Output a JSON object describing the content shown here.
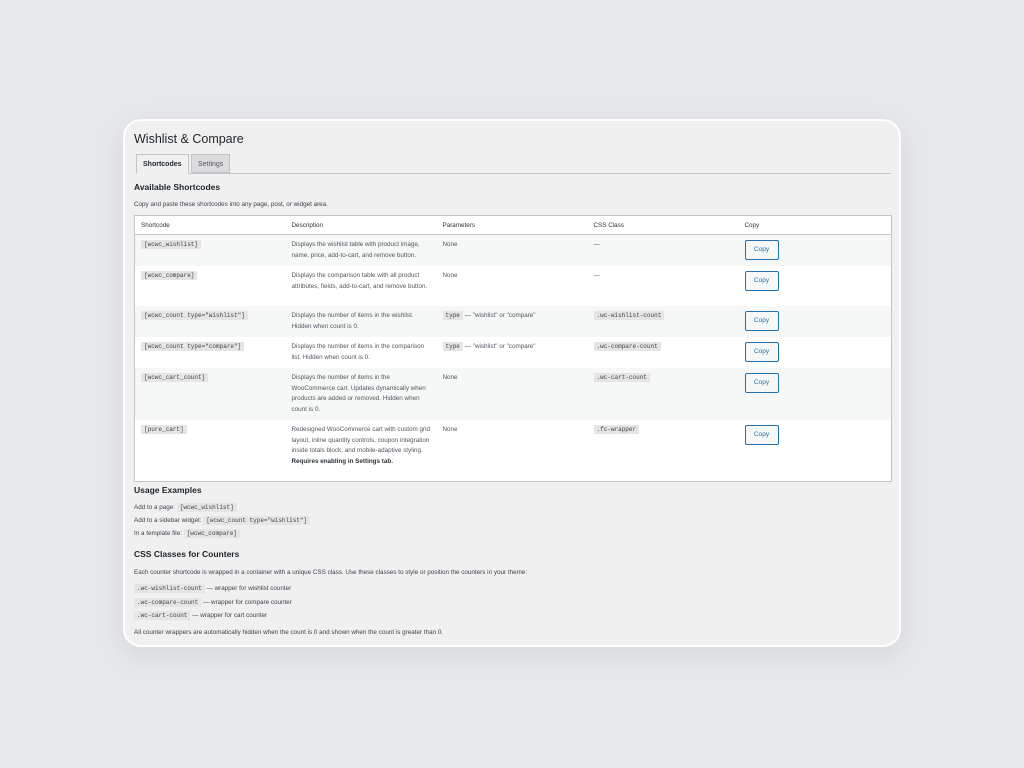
{
  "page": {
    "title": "Wishlist & Compare"
  },
  "tabs": [
    {
      "label": "Shortcodes",
      "active": true
    },
    {
      "label": "Settings",
      "active": false
    }
  ],
  "shortcodes_section": {
    "heading": "Available Shortcodes",
    "intro": "Copy and paste these shortcodes into any page, post, or widget area.",
    "columns": [
      "Shortcode",
      "Description",
      "Parameters",
      "CSS Class",
      "Copy"
    ],
    "rows": [
      {
        "shortcode": "[wcwc_wishlist]",
        "description": "Displays the wishlist table with product image, name, price, add-to-cart, and remove button.",
        "param_code": "",
        "param_text": "None",
        "css_class": "",
        "css_dash": "—",
        "copy": "Copy"
      },
      {
        "shortcode": "[wcwc_compare]",
        "description": "Displays the comparison table with all product attributes, fields, add-to-cart, and remove button.",
        "param_code": "",
        "param_text": "None",
        "css_class": "",
        "css_dash": "—",
        "copy": "Copy"
      },
      {
        "shortcode": "[wcwc_count type=\"wishlist\"]",
        "description": "Displays the number of items in the wishlist. Hidden when count is 0.",
        "param_code": "type",
        "param_text": "— \"wishlist\" or \"compare\"",
        "css_class": ".wc-wishlist-count",
        "css_dash": "",
        "copy": "Copy"
      },
      {
        "shortcode": "[wcwc_count type=\"compare\"]",
        "description": "Displays the number of items in the comparison list. Hidden when count is 0.",
        "param_code": "type",
        "param_text": "— \"wishlist\" or \"compare\"",
        "css_class": ".wc-compare-count",
        "css_dash": "",
        "copy": "Copy"
      },
      {
        "shortcode": "[wcwc_cart_count]",
        "description": "Displays the number of items in the WooCommerce cart. Updates dynamically when products are added or removed. Hidden when count is 0.",
        "param_code": "",
        "param_text": "None",
        "css_class": ".wc-cart-count",
        "css_dash": "",
        "copy": "Copy"
      },
      {
        "shortcode": "[pure_cart]",
        "description": "Redesigned WooCommerce cart with custom grid layout, inline quantity controls, coupon integration inside totals block, and mobile-adaptive styling.",
        "description_bold": "Requires enabling in Settings tab.",
        "param_code": "",
        "param_text": "None",
        "css_class": ".fc-wrapper",
        "css_dash": "",
        "copy": "Copy"
      }
    ]
  },
  "usage_section": {
    "heading": "Usage Examples",
    "examples": [
      {
        "label": "Add to a page:",
        "code": "[wcwc_wishlist]"
      },
      {
        "label": "Add to a sidebar widget:",
        "code": "[wcwc_count type=\"wishlist\"]"
      },
      {
        "label": "In a template file:",
        "code": "[wcwc_compare]"
      }
    ]
  },
  "css_section": {
    "heading": "CSS Classes for Counters",
    "intro": "Each counter shortcode is wrapped in a container with a unique CSS class. Use these classes to style or position the counters in your theme:",
    "classes": [
      {
        "code": ".wc-wishlist-count",
        "text": "— wrapper for wishlist counter"
      },
      {
        "code": ".wc-compare-count",
        "text": "— wrapper for compare counter"
      },
      {
        "code": ".wc-cart-count",
        "text": "— wrapper for cart counter"
      }
    ],
    "footer": "All counter wrappers are automatically hidden when the count is 0 and shown when the count is greater than 0."
  },
  "colors": {
    "accent": "#2271b1",
    "background": "#f0f0f1",
    "page_bg": "#e6e8eb"
  }
}
